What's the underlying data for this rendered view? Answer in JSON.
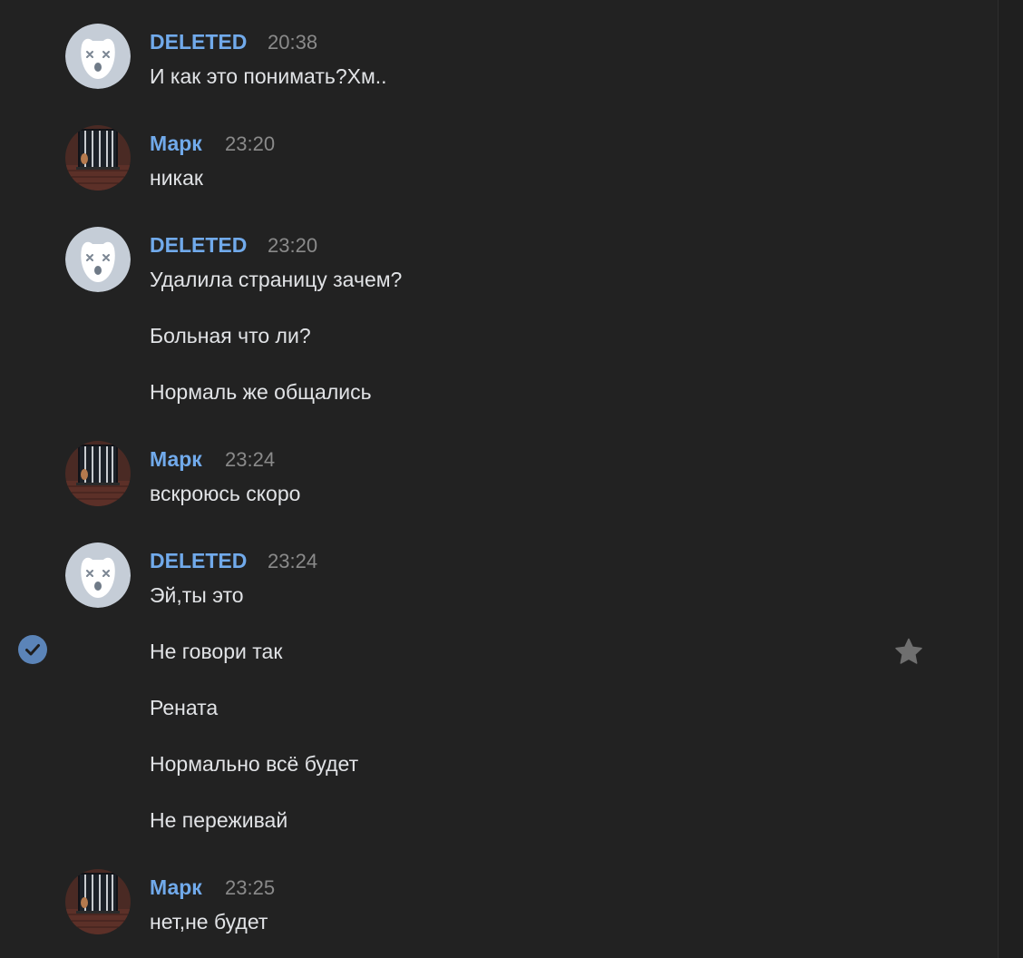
{
  "messages": [
    {
      "sender": "DELETED",
      "time": "20:38",
      "avatar_icon": "deleted-dog-icon",
      "lines": [
        "И как это понимать?Хм.."
      ]
    },
    {
      "sender": "Марк",
      "time": "23:20",
      "avatar_icon": "photo-avatar",
      "lines": [
        "никак"
      ]
    },
    {
      "sender": "DELETED",
      "time": "23:20",
      "avatar_icon": "deleted-dog-icon",
      "lines": [
        "Удалила страницу зачем?",
        "Больная что ли?",
        "Нормаль же общались"
      ]
    },
    {
      "sender": "Марк",
      "time": "23:24",
      "avatar_icon": "photo-avatar",
      "lines": [
        "вскроюсь скоро"
      ]
    },
    {
      "sender": "DELETED",
      "time": "23:24",
      "avatar_icon": "deleted-dog-icon",
      "lines": [
        "Эй,ты это",
        "Не говори так",
        "Рената",
        "Нормально всё будет",
        "Не переживай"
      ]
    },
    {
      "sender": "Марк",
      "time": "23:25",
      "avatar_icon": "photo-avatar",
      "lines": [
        "нет,не будет"
      ]
    }
  ],
  "selection": {
    "icon": "checkmark-circle-icon",
    "selected": true
  },
  "favorite": {
    "icon": "star-icon"
  },
  "colors": {
    "background": "#222222",
    "sender_name": "#71aaeb",
    "timestamp": "#8a8a8a",
    "message_text": "#e1e3e6",
    "check": "#5b84b8",
    "star": "#6f6f6f"
  }
}
